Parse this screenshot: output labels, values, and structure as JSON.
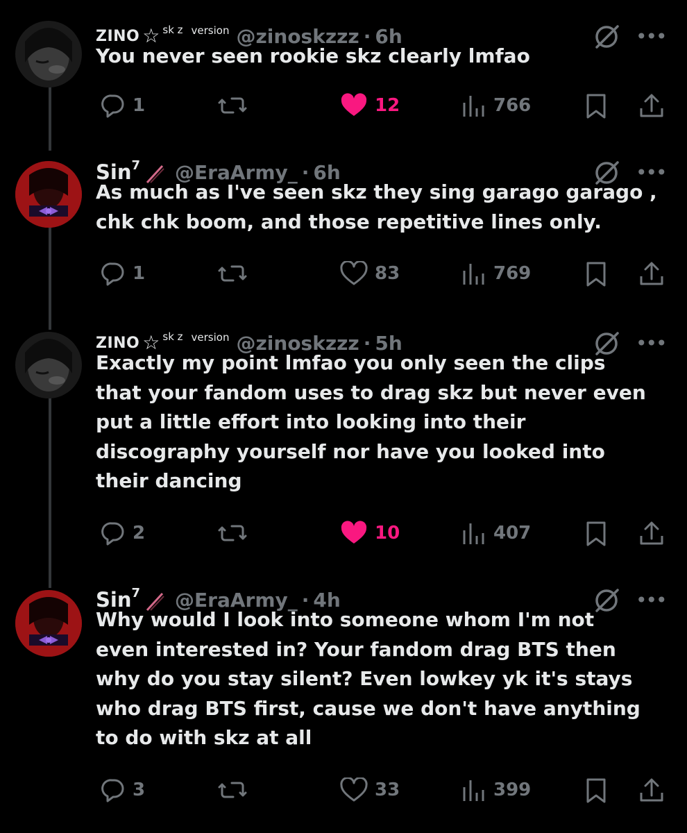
{
  "tweets": [
    {
      "name": "ZINO",
      "name_style": "zino",
      "star": "☆",
      "deco1": "sk z",
      "deco2": "version",
      "handle": "@zinoskzzz",
      "dot": "·",
      "time": "6h",
      "text": "You never seen rookie skz clearly lmfao",
      "replies": "1",
      "likes": "12",
      "liked": true,
      "views": "766"
    },
    {
      "name": "Sin",
      "name_style": "sin",
      "sup": "7",
      "handle": "@EraArmy_",
      "dot": "·",
      "time": "6h",
      "text": "As much as I've seen skz they sing garago garago ,\nchk chk boom, and those repetitive lines only.",
      "replies": "1",
      "likes": "83",
      "liked": false,
      "views": "769"
    },
    {
      "name": "ZINO",
      "name_style": "zino",
      "star": "☆",
      "deco1": "sk z",
      "deco2": "version",
      "handle": "@zinoskzzz",
      "dot": "·",
      "time": "5h",
      "text": "Exactly my point lmfao you only seen the clips\nthat your fandom uses to drag skz but never even\nput a little effort into looking into their\ndiscography yourself nor have you looked into\ntheir dancing",
      "replies": "2",
      "likes": "10",
      "liked": true,
      "views": "407"
    },
    {
      "name": "Sin",
      "name_style": "sin",
      "sup": "7",
      "handle": "@EraArmy_",
      "dot": "·",
      "time": "4h",
      "text": "Why would I look into someone whom I'm not\neven interested in? Your fandom drag BTS then\nwhy do you stay silent? Even lowkey yk it's stays\nwho drag BTS first, cause we don't have anything\nto do with skz at all",
      "replies": "3",
      "likes": "33",
      "liked": false,
      "views": "399"
    }
  ],
  "icons": {
    "reply": "reply-icon",
    "retweet": "retweet-icon",
    "like": "heart-icon",
    "views": "views-icon",
    "bookmark": "bookmark-icon",
    "share": "share-icon",
    "grok": "slash-circle-icon",
    "more": "more-icon"
  },
  "colors": {
    "background": "#000000",
    "text": "#e7e9ea",
    "muted": "#71767b",
    "like": "#f91880",
    "thread_line": "#333639"
  }
}
